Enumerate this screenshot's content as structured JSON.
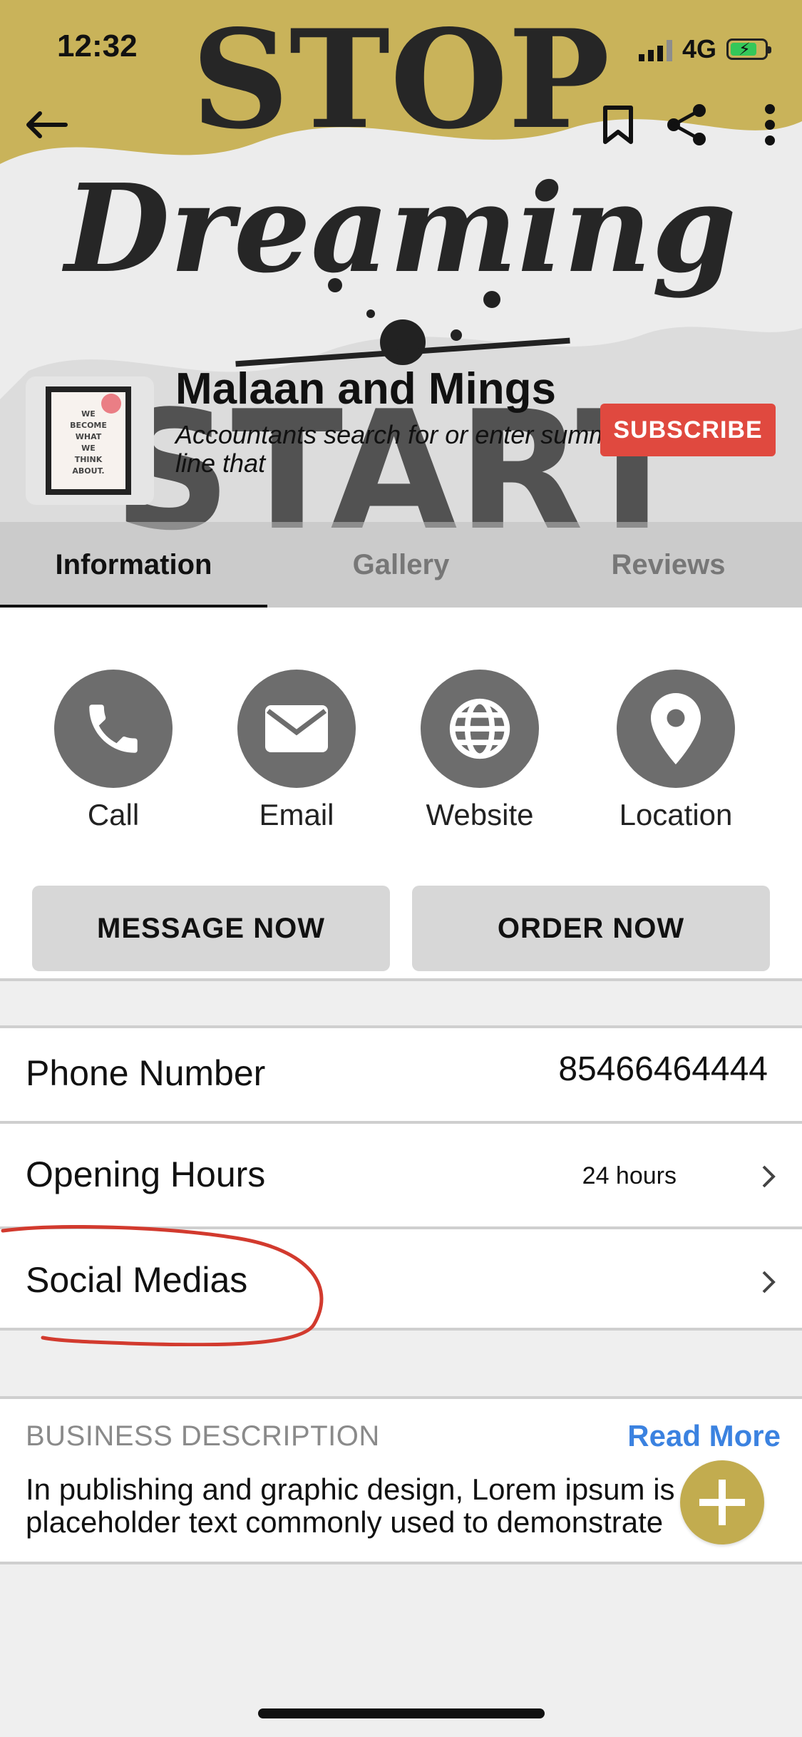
{
  "status": {
    "time": "12:32",
    "network": "4G"
  },
  "hero": {
    "poster_text": {
      "line1": "STOP",
      "line2": "Dreaming",
      "line3": "START"
    },
    "thumb_text": [
      "WE",
      "BECOME",
      "WHAT",
      "WE",
      "THINK",
      "ABOUT."
    ],
    "business_name": "Malaan and Mings",
    "tagline": "Accountants search for or enter summary line that",
    "subscribe_label": "SUBSCRIBE"
  },
  "tabs": [
    {
      "label": "Information",
      "active": true
    },
    {
      "label": "Gallery",
      "active": false
    },
    {
      "label": "Reviews",
      "active": false
    }
  ],
  "actions": [
    {
      "label": "Call",
      "icon": "phone-icon"
    },
    {
      "label": "Email",
      "icon": "mail-icon"
    },
    {
      "label": "Website",
      "icon": "globe-icon"
    },
    {
      "label": "Location",
      "icon": "location-pin-icon"
    }
  ],
  "cta": {
    "message": "MESSAGE NOW",
    "order": "ORDER NOW"
  },
  "info": {
    "phone_label": "Phone Number",
    "phone_value": "85466464444",
    "hours_label": "Opening Hours",
    "hours_value": "24 hours",
    "social_label": "Social Medias"
  },
  "description": {
    "title": "BUSINESS DESCRIPTION",
    "read_more": "Read More",
    "text": "In publishing and graphic design, Lorem ipsum is a placeholder text commonly used to demonstrate"
  },
  "colors": {
    "subscribe": "#e0493f",
    "link": "#3b82e0",
    "fab": "#c2ac4f",
    "annotation": "#d23a2e"
  }
}
